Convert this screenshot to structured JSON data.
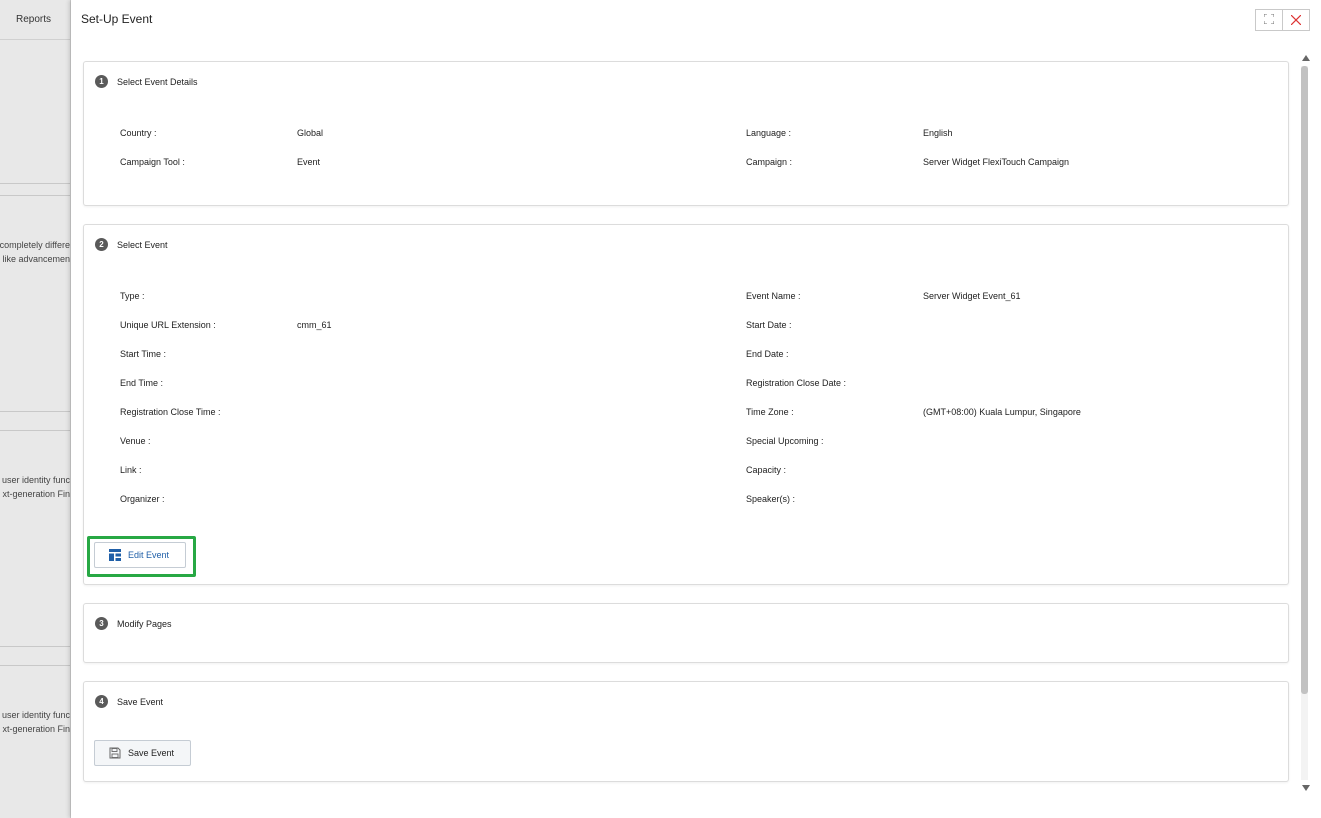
{
  "background": {
    "tab_label": "Reports",
    "snippets": [
      {
        "line1": "completely differe",
        "line2": "like advancemen"
      },
      {
        "line1": "user identity func",
        "line2": "xt-generation Fin"
      },
      {
        "line1": "user identity func",
        "line2": "xt-generation Fin"
      }
    ]
  },
  "drawer": {
    "title": "Set-Up Event",
    "maximize_icon": "⛶",
    "close_icon": "✕"
  },
  "section1": {
    "step": "1",
    "title": "Select Event Details",
    "fields": [
      {
        "label": "Country :",
        "value": "Global"
      },
      {
        "label": "Language :",
        "value": "English"
      },
      {
        "label": "Campaign Tool :",
        "value": "Event"
      },
      {
        "label": "Campaign :",
        "value": "Server Widget FlexiTouch Campaign"
      }
    ]
  },
  "section2": {
    "step": "2",
    "title": "Select Event",
    "fields": [
      {
        "label": "Type :",
        "value": ""
      },
      {
        "label": "Event Name :",
        "value": "Server Widget Event_61"
      },
      {
        "label": "Unique URL Extension :",
        "value": "cmm_61"
      },
      {
        "label": "Start Date :",
        "value": ""
      },
      {
        "label": "Start Time :",
        "value": ""
      },
      {
        "label": "End Date :",
        "value": ""
      },
      {
        "label": "End Time :",
        "value": ""
      },
      {
        "label": "Registration Close Date :",
        "value": ""
      },
      {
        "label": "Registration Close Time :",
        "value": ""
      },
      {
        "label": "Time Zone :",
        "value": "(GMT+08:00) Kuala Lumpur, Singapore"
      },
      {
        "label": "Venue :",
        "value": ""
      },
      {
        "label": "Special Upcoming :",
        "value": ""
      },
      {
        "label": "Link :",
        "value": ""
      },
      {
        "label": "Capacity :",
        "value": ""
      },
      {
        "label": "Organizer :",
        "value": ""
      },
      {
        "label": "Speaker(s) :",
        "value": ""
      }
    ],
    "edit_button": "Edit Event"
  },
  "section3": {
    "step": "3",
    "title": "Modify Pages"
  },
  "section4": {
    "step": "4",
    "title": "Save Event",
    "save_button": "Save Event"
  },
  "colors": {
    "highlight": "#27a844",
    "link_blue": "#1f5fa8"
  }
}
